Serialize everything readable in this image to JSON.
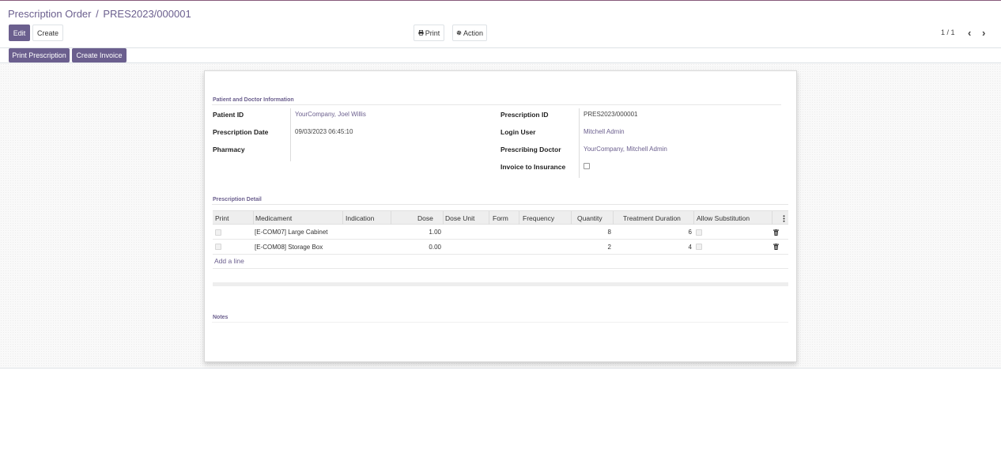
{
  "breadcrumb": {
    "parent": "Prescription Order",
    "separator": "/",
    "current": "PRES2023/000001"
  },
  "toolbar": {
    "edit_label": "Edit",
    "create_label": "Create",
    "print_label": "Print",
    "action_label": "Action",
    "print_icon": "printer-icon",
    "action_icon": "gear-icon"
  },
  "pager": {
    "value": "1 / 1",
    "prev_icon": "chevron-left-icon",
    "next_icon": "chevron-right-icon"
  },
  "statusbar": {
    "print_prescription_label": "Print Prescription",
    "create_invoice_label": "Create Invoice"
  },
  "colors": {
    "accent": "#6b5f8e",
    "brand_line": "#875a7b"
  },
  "form": {
    "section_patient_title": "Patient and Doctor Information",
    "left": {
      "patient_id_label": "Patient ID",
      "patient_id_value": "YourCompany, Joel Willis",
      "prescription_date_label": "Prescription Date",
      "prescription_date_value": "09/03/2023 06:45:10",
      "pharmacy_label": "Pharmacy",
      "pharmacy_value": ""
    },
    "right": {
      "prescription_id_label": "Prescription ID",
      "prescription_id_value": "PRES2023/000001",
      "login_user_label": "Login User",
      "login_user_value": "Mitchell Admin",
      "prescribing_doctor_label": "Prescribing Doctor",
      "prescribing_doctor_value": "YourCompany, Mitchell Admin",
      "invoice_insurance_label": "Invoice to Insurance",
      "invoice_insurance_checked": false
    },
    "section_detail_title": "Prescription Detail",
    "table": {
      "columns": [
        "Print",
        "Medicament",
        "Indication",
        "Dose",
        "Dose Unit",
        "Form",
        "Frequency",
        "Quantity",
        "Treatment Duration",
        "Allow Substitution"
      ],
      "rows": [
        {
          "print": false,
          "medicament": "[E-COM07] Large Cabinet",
          "indication": "",
          "dose": "1.00",
          "dose_unit": "",
          "form": "",
          "frequency": "",
          "quantity": "8",
          "treatment_duration": "6",
          "allow_substitution": false
        },
        {
          "print": false,
          "medicament": "[E-COM08] Storage Box",
          "indication": "",
          "dose": "0.00",
          "dose_unit": "",
          "form": "",
          "frequency": "",
          "quantity": "2",
          "treatment_duration": "4",
          "allow_substitution": false
        }
      ],
      "add_line_label": "Add a line",
      "row_delete_icon": "trash-icon",
      "column_options_icon": "vertical-dots-icon"
    },
    "section_notes_title": "Notes"
  }
}
